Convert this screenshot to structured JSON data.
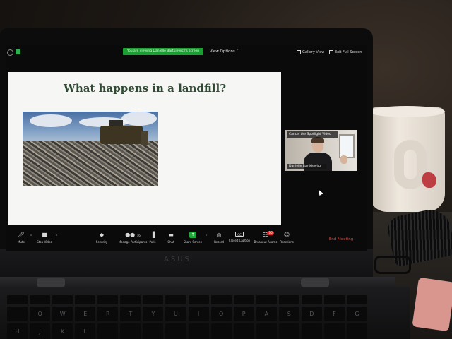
{
  "zoom": {
    "viewing_banner": "You are viewing Danielle Bartkiewicz's screen",
    "view_options": "View Options ˅",
    "gallery_view": "Gallery View",
    "exit_full_screen": "Exit Full Screen"
  },
  "slide": {
    "title": "What happens in a landfill?"
  },
  "spotlight": {
    "cancel_label": "Cancel the Spotlight Video",
    "name": "Danielle Bartkiewicz"
  },
  "toolbar": {
    "mute": "Mute",
    "stop_video": "Stop Video",
    "security": "Security",
    "manage_participants": "Manage Participants",
    "participant_count": "16",
    "polls": "Polls",
    "chat": "Chat",
    "share_screen": "Share Screen",
    "record": "Record",
    "closed_caption": "Closed Caption",
    "breakout_rooms": "Breakout Rooms",
    "breakout_badge": "16",
    "reactions": "Reactions",
    "end_meeting": "End Meeting"
  },
  "laptop": {
    "brand": "ASUS",
    "keys": [
      "Q",
      "W",
      "E",
      "R",
      "T",
      "Y",
      "U",
      "I",
      "O",
      "P",
      "A",
      "S",
      "D",
      "F",
      "G",
      "H",
      "J",
      "K",
      "L"
    ]
  },
  "icons": [
    "info-icon",
    "lock-icon",
    "gallery-icon",
    "exit-fullscreen-icon",
    "microphone-icon",
    "video-camera-icon",
    "shield-icon",
    "participants-icon",
    "polls-icon",
    "chat-icon",
    "share-screen-icon",
    "record-icon",
    "cc-icon",
    "breakout-icon",
    "reactions-icon"
  ],
  "colors": {
    "zoom_green": "#1aa032",
    "end_red": "#e8443a",
    "slide_title": "#2f4a32"
  }
}
